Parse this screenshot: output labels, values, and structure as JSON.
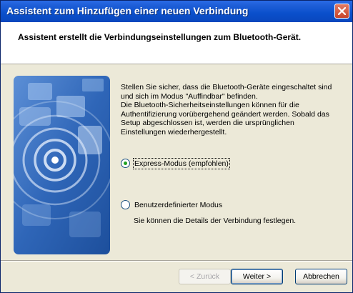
{
  "window": {
    "title": "Assistent zum Hinzufügen einer neuen Verbindung"
  },
  "header": {
    "title": "Assistent erstellt die Verbindungseinstellungen zum Bluetooth-Gerät."
  },
  "body": {
    "lines": [
      "Stellen Sie sicher, dass die Bluetooth-Geräte eingeschaltet sind",
      "und sich im Modus \"Auffindbar\" befinden.",
      "Die Bluetooth-Sicherheitseinstellungen können für die",
      "Authentifizierung vorübergehend geändert werden. Sobald das",
      "Setup abgeschlossen ist, werden die ursprünglichen",
      "Einstellungen wiederhergestellt."
    ]
  },
  "options": {
    "express_label": "Express-Modus (empfohlen)",
    "express_selected": true,
    "custom_label": "Benutzerdefinierter Modus",
    "custom_selected": false,
    "custom_description": "Sie können die Details der Verbindung festlegen."
  },
  "buttons": {
    "back_label": "< Zurück",
    "next_label": "Weiter >",
    "cancel_label": "Abbrechen"
  },
  "icons": {
    "close": "close-icon",
    "wizard_art": "bluetooth-devices-illustration"
  },
  "colors": {
    "titlebar": "#0a4fcb",
    "dialog_bg": "#ece9d8",
    "art_blue": "#2a5fb0"
  }
}
